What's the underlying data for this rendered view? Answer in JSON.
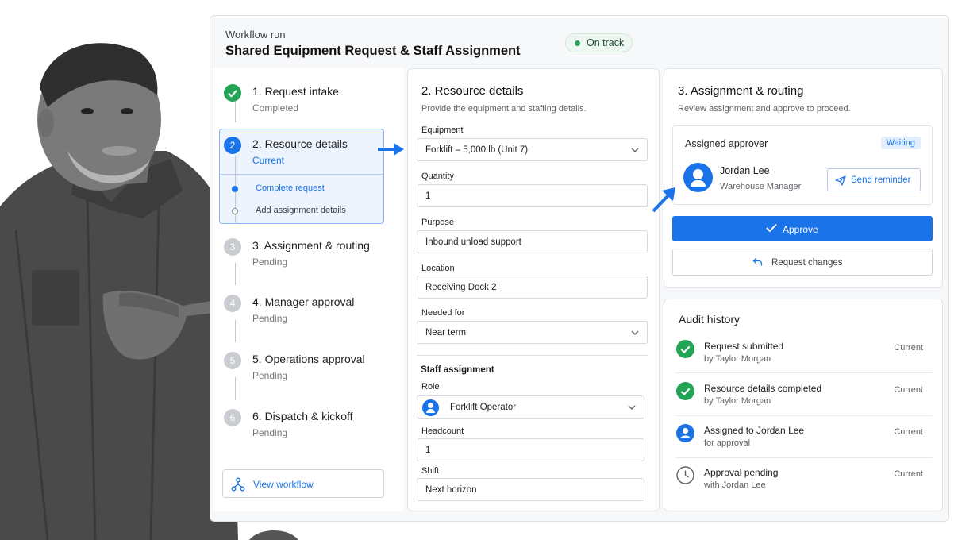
{
  "header": {
    "subtitle": "Workflow run",
    "title": "Shared Equipment Request & Staff Assignment",
    "status": "On track"
  },
  "steps": [
    {
      "title": "1.  Request intake",
      "status": "Completed"
    },
    {
      "title": "2. Resource details",
      "status": "Current",
      "substeps": [
        "Complete request",
        "Add assignment details"
      ]
    },
    {
      "title": "3. Assignment & routing",
      "status": "Pending"
    },
    {
      "title": "4.  Manager approval",
      "status": "Pending"
    },
    {
      "title": "5.  Operations approval",
      "status": "Pending"
    },
    {
      "title": "6.  Dispatch & kickoff",
      "status": "Pending"
    }
  ],
  "step_numbers": [
    "2",
    "3",
    "4",
    "5",
    "6"
  ],
  "view_workflow": "View workflow",
  "resource": {
    "title": "2.  Resource details",
    "description": "Provide the equipment and staffing details.",
    "fields": {
      "equipment": {
        "label": "Equipment",
        "value": "Forklift – 5,000 lb (Unit 7)"
      },
      "quantity": {
        "label": "Quantity",
        "value": "1"
      },
      "purpose": {
        "label": "Purpose",
        "value": "Inbound unload support"
      },
      "location": {
        "label": "Location",
        "value": "Receiving Dock 2"
      },
      "needed_for": {
        "label": "Needed for",
        "value": "Near term"
      }
    },
    "staff": {
      "heading": "Staff assignment",
      "role": {
        "label": "Role",
        "value": "Forklift Operator"
      },
      "headcount": {
        "label": "Headcount",
        "value": "1"
      },
      "shift": {
        "label": "Shift",
        "value": "Next horizon"
      }
    }
  },
  "assignment": {
    "title": "3.  Assignment & routing",
    "description": "Review assignment and approve to proceed.",
    "approver_heading": "Assigned approver",
    "approver_status": "Waiting",
    "approver_name": "Jordan Lee",
    "approver_role": "Warehouse Manager",
    "reminder_label": "Send reminder",
    "approve_label": "Approve",
    "changes_label": "Request changes"
  },
  "audit": {
    "title": "Audit history",
    "items": [
      {
        "title": "Request submitted",
        "detail": "by Taylor Morgan",
        "tag": "Current",
        "icon": "check-circle-icon"
      },
      {
        "title": "Resource details completed",
        "detail": "by Taylor Morgan",
        "tag": "Current",
        "icon": "check-circle-icon"
      },
      {
        "title": "Assigned to Jordan Lee",
        "detail": "for approval",
        "tag": "Current",
        "icon": "user-avatar-icon"
      },
      {
        "title": "Approval pending",
        "detail": "with Jordan Lee",
        "tag": "Current",
        "icon": "clock-icon"
      }
    ]
  },
  "colors": {
    "accent": "#1a73e8",
    "success": "#23a356",
    "pending": "#c9ccd0"
  }
}
